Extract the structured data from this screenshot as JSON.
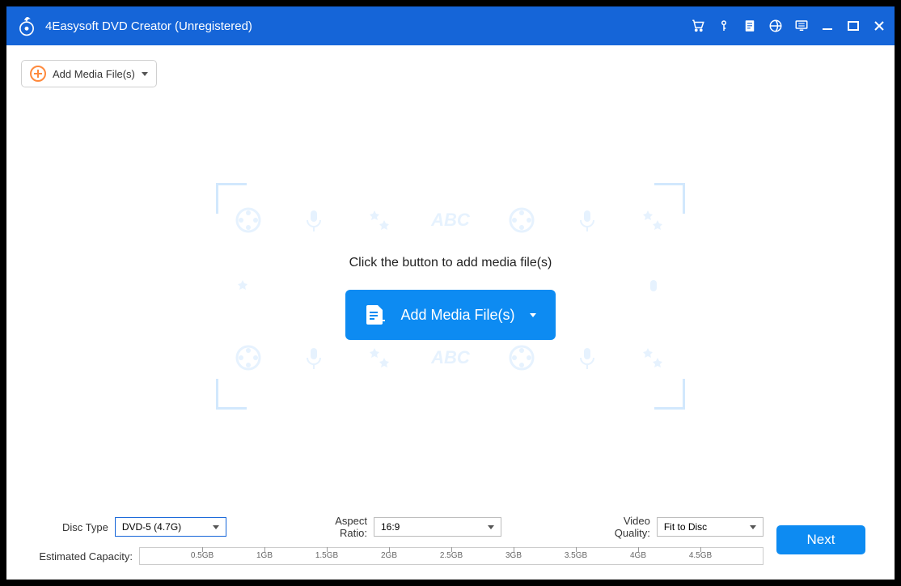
{
  "titlebar": {
    "title": "4Easysoft DVD Creator (Unregistered)"
  },
  "toolbar": {
    "add_media_label": "Add Media File(s)"
  },
  "dropzone": {
    "instruction": "Click the button to add media file(s)",
    "button_label": "Add Media File(s)",
    "bg_text": "ABC"
  },
  "options": {
    "disc_type_label": "Disc Type",
    "disc_type_value": "DVD-5 (4.7G)",
    "aspect_label": "Aspect Ratio:",
    "aspect_value": "16:9",
    "quality_label": "Video Quality:",
    "quality_value": "Fit to Disc"
  },
  "capacity": {
    "label": "Estimated Capacity:",
    "ticks": [
      "0.5GB",
      "1GB",
      "1.5GB",
      "2GB",
      "2.5GB",
      "3GB",
      "3.5GB",
      "4GB",
      "4.5GB"
    ]
  },
  "actions": {
    "next_label": "Next"
  }
}
